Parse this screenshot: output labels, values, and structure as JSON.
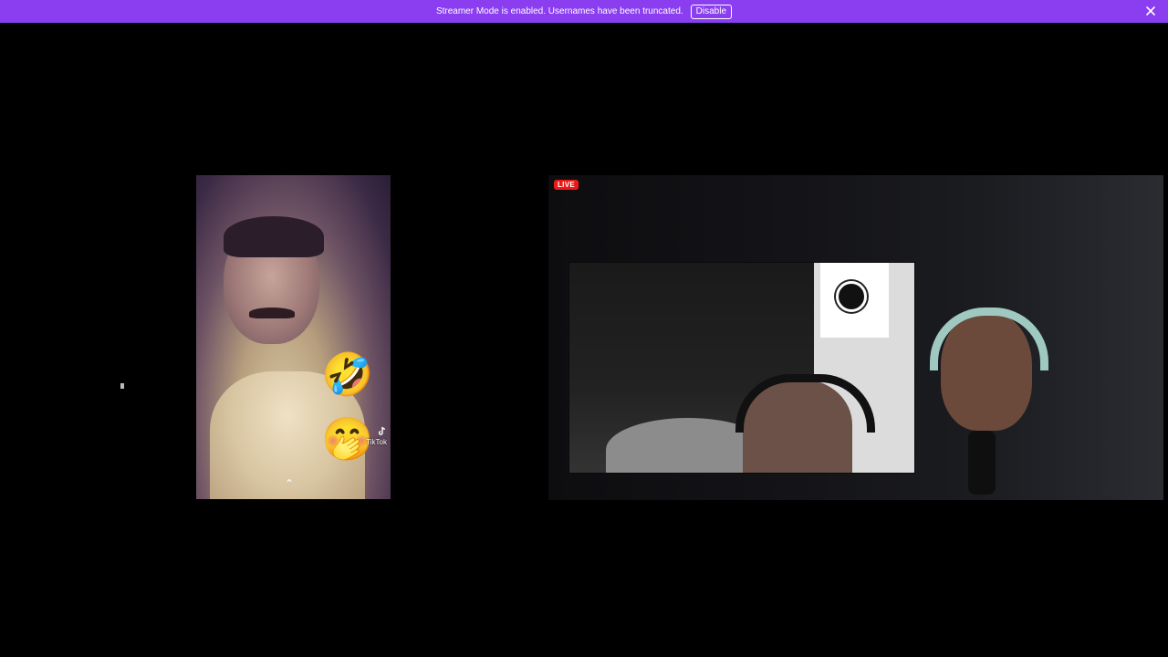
{
  "banner": {
    "message": "Streamer Mode is enabled. Usernames have been truncated.",
    "disable_label": "Disable",
    "close_icon": "close-icon",
    "background": "#8a3ef0"
  },
  "clip": {
    "watermark_brand": "TikTok",
    "emojis": [
      "🤣",
      "🤭"
    ]
  },
  "stream": {
    "live_label": "LIVE",
    "live_color": "#e91916"
  }
}
